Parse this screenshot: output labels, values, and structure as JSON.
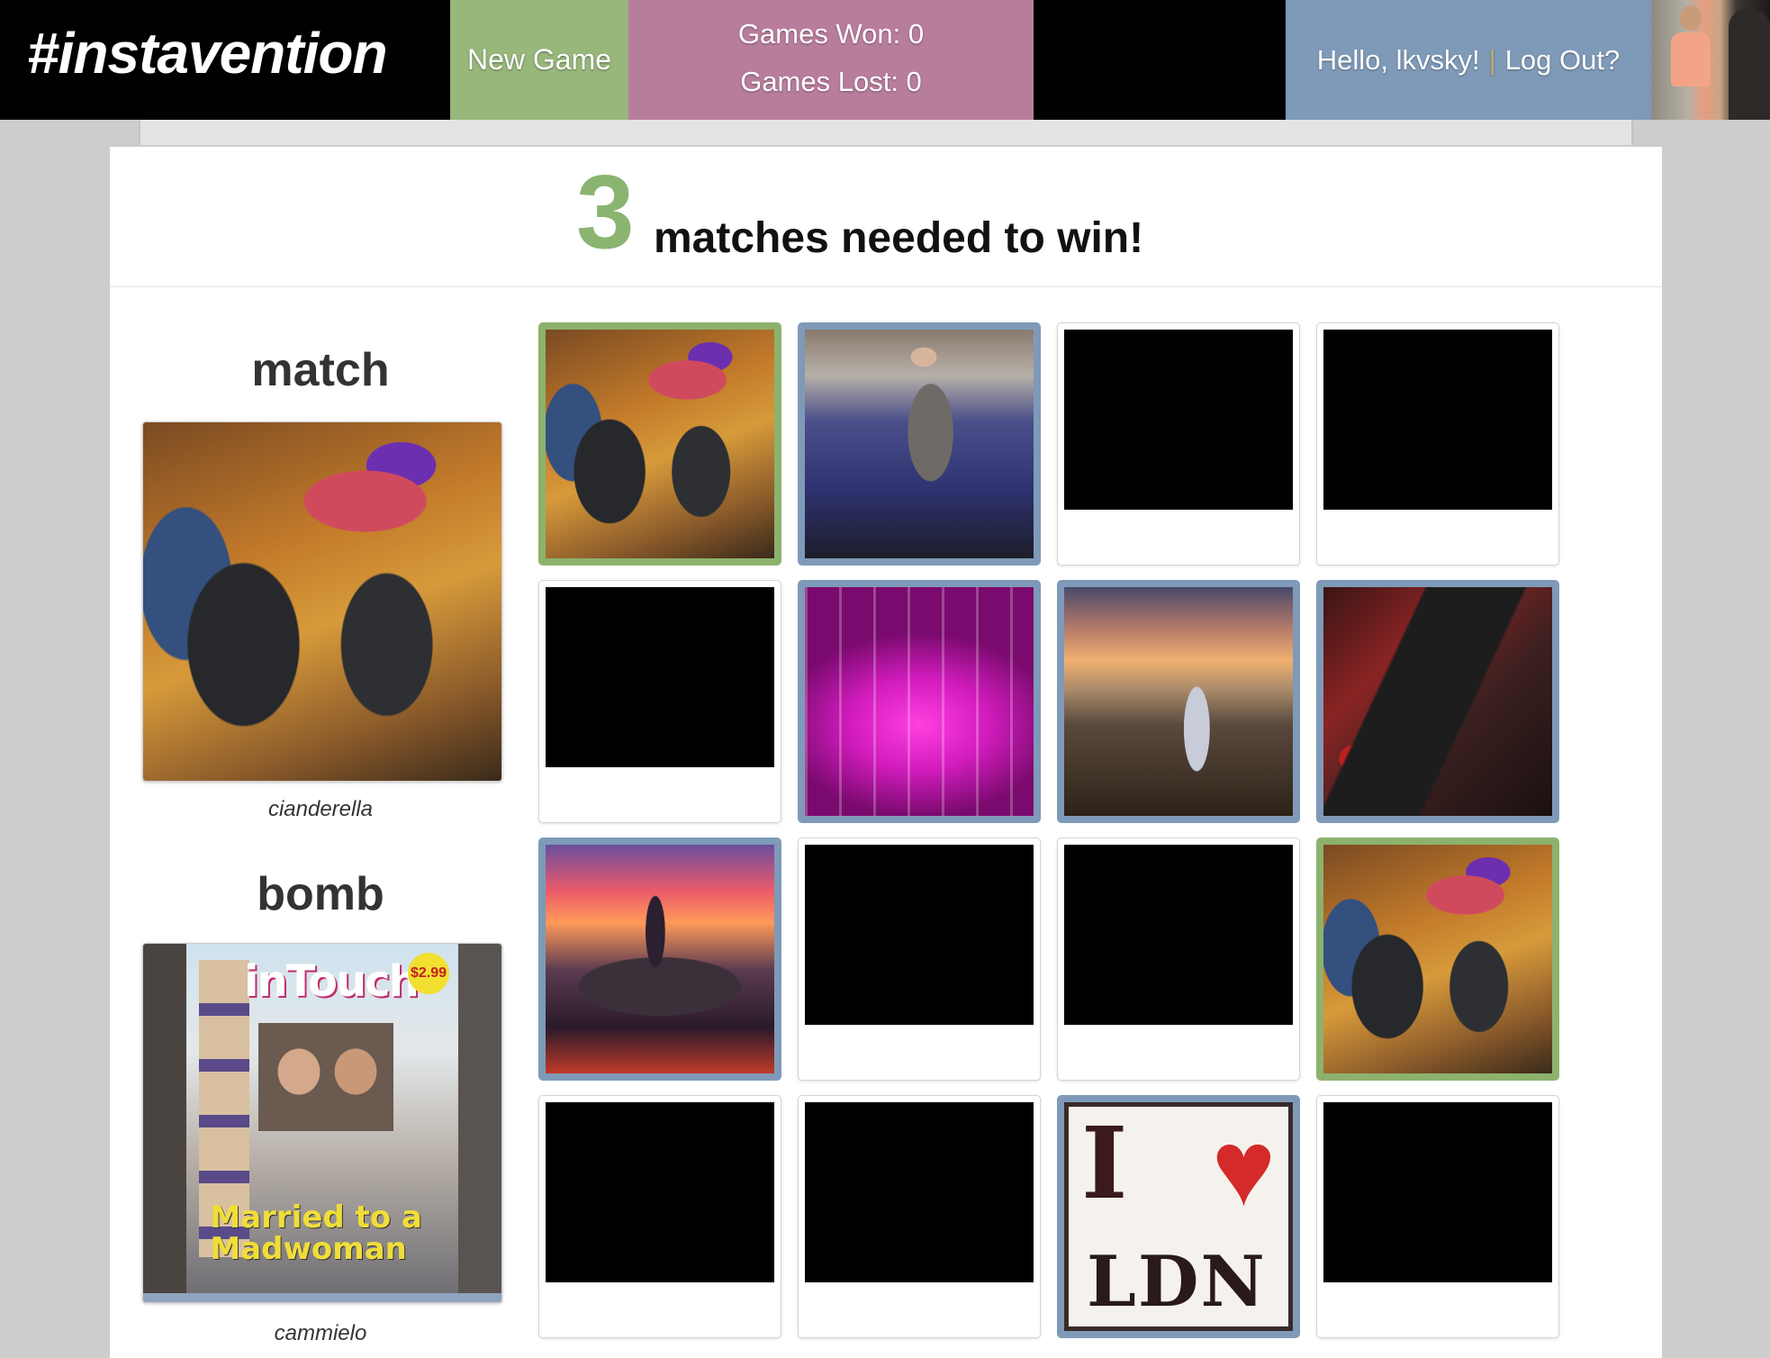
{
  "header": {
    "logo": "#instavention",
    "new_game": "New Game",
    "games_won": "Games Won: 0",
    "games_lost": "Games Lost: 0",
    "greeting": "Hello, lkvsky!",
    "separator": "|",
    "logout": "Log Out?"
  },
  "banner": {
    "count": "3",
    "text": "matches needed to win!"
  },
  "side": {
    "match_label": "match",
    "match_user": "cianderella",
    "bomb_label": "bomb",
    "bomb_user": "cammielo"
  },
  "photos": {
    "ldn_letter": "I",
    "ldn_heart": "♥",
    "ldn_city": "LDN",
    "mag_title": "inTouch",
    "mag_price": "$2.99",
    "mag_headline_1": "Married to a",
    "mag_headline_2": "Madwoman"
  },
  "colors": {
    "matched": "#8db26d",
    "revealed": "#7f9ab8",
    "new_game_bg": "#97b77b",
    "stats_bg": "#b97d9c",
    "user_bg": "#7f9ab8"
  },
  "grid": [
    [
      "matched-shoes",
      "revealed-bar",
      "hidden",
      "hidden"
    ],
    [
      "hidden",
      "revealed-glasses",
      "revealed-sunset",
      "revealed-loko"
    ],
    [
      "revealed-castle",
      "hidden",
      "hidden",
      "matched-shoes"
    ],
    [
      "hidden",
      "hidden",
      "revealed-ldn",
      "hidden"
    ]
  ]
}
